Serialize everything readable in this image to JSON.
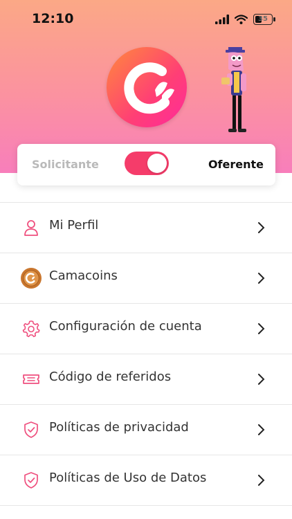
{
  "status_bar": {
    "time": "12:10",
    "battery": "35"
  },
  "role_switch": {
    "left_label": "Solicitante",
    "right_label": "Oferente",
    "active": "Oferente"
  },
  "menu": [
    {
      "label": "Mi Perfil",
      "icon": "user-icon"
    },
    {
      "label": "Camacoins",
      "icon": "coin-icon"
    },
    {
      "label": "Configuración de cuenta",
      "icon": "gear-icon"
    },
    {
      "label": "Código de referidos",
      "icon": "ticket-icon"
    },
    {
      "label": "Políticas de privacidad",
      "icon": "shield-check-icon"
    },
    {
      "label": "Políticas de Uso de Datos",
      "icon": "shield-check-icon"
    }
  ],
  "colors": {
    "accent": "#f53c6a",
    "header_top": "#fba886",
    "header_bottom": "#f87ebb"
  }
}
